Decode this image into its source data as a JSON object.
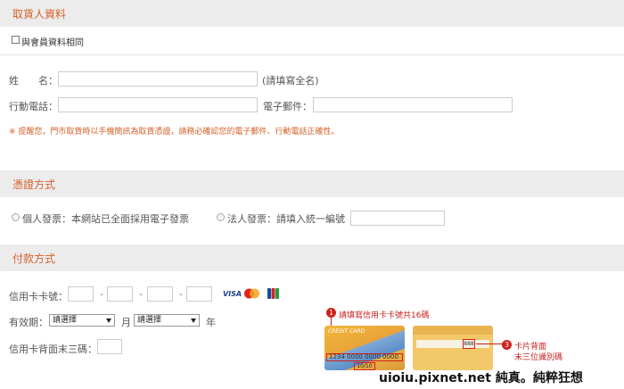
{
  "pickup": {
    "title": "取貨人資料",
    "same_as_member": "與會員資料相同",
    "name_label": "姓　　名：",
    "name_hint": "(請填寫全名)",
    "phone_label": "行動電話：",
    "email_label": "電子郵件：",
    "notice": "※ 提醒您，門市取貨時以手機簡訊為取貨憑證，請務必確認您的電子郵件、行動電話正確性。"
  },
  "voucher": {
    "title": "憑證方式",
    "personal": "個人發票：本網站已全面採用電子發票",
    "company": "法人發票：請填入統一編號"
  },
  "payment": {
    "title": "付款方式",
    "card_number_label": "信用卡卡號：",
    "dash": "-",
    "expiry_label": "有效期：",
    "select_placeholder": "請選擇",
    "month_label": "月",
    "year_label": "年",
    "cvv_label": "信用卡背面末三碼：",
    "brands": [
      "VISA",
      "MasterCard",
      "JCB"
    ],
    "brand_colors": {
      "visa": "#1a3d8f",
      "master_red": "#e2231a",
      "master_yellow": "#f7a21b"
    }
  },
  "card_illustration": {
    "step1_num": "1",
    "step1_text": "請填寫信用卡卡號共16碼",
    "front_title": "CREDIT CARD",
    "front_number": "1234 0000 0000 0000",
    "front_expiry": "10/10",
    "back_code": "888",
    "step3_num": "3",
    "step3_text_line1": "卡片背面",
    "step3_text_line2": "末三位識別碼"
  },
  "watermark": "uioiu.pixnet.net 純真。純粹狂想"
}
